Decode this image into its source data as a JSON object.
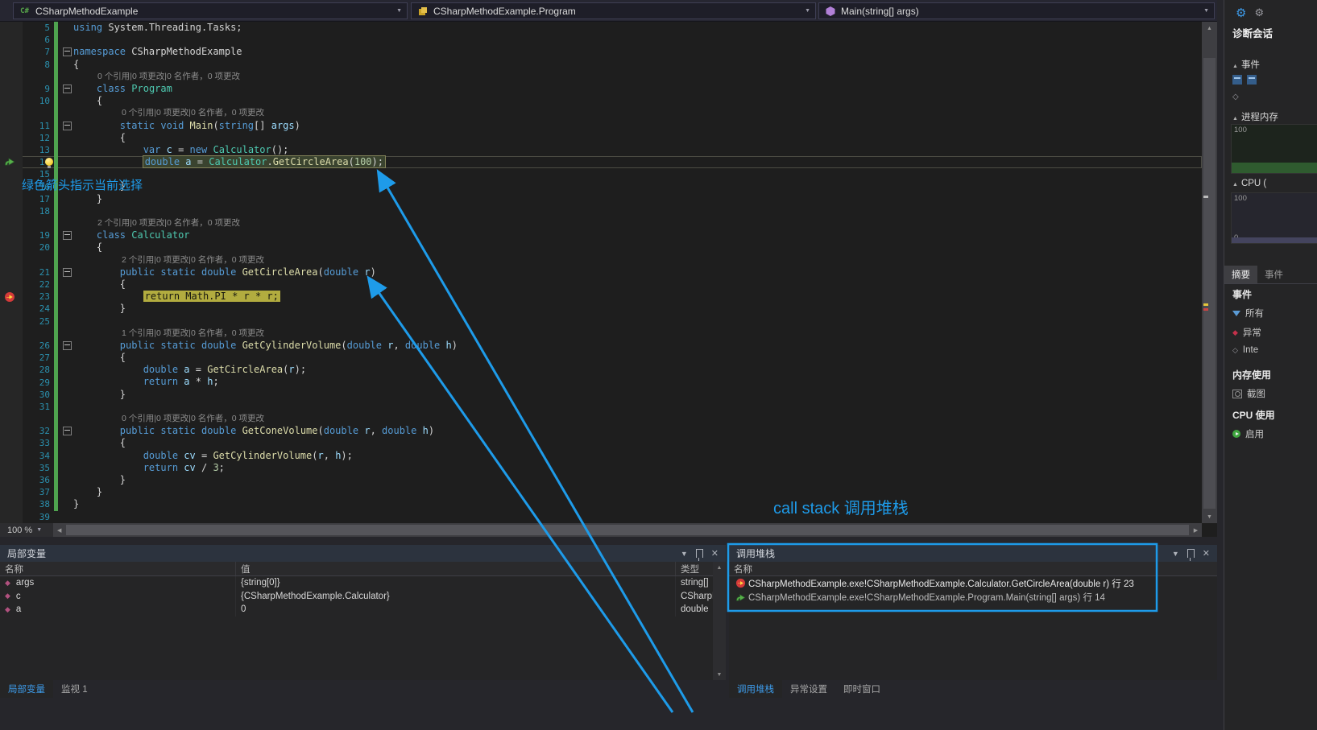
{
  "topbar": {
    "dropdowns": [
      {
        "icon": "csharp-project-icon",
        "label": "CSharpMethodExample"
      },
      {
        "icon": "class-icon",
        "label": "CSharpMethodExample.Program"
      },
      {
        "icon": "method-icon",
        "label": "Main(string[] args)"
      }
    ]
  },
  "editor": {
    "zoom": "100 %",
    "rows": [
      {
        "n": "5",
        "g": 1,
        "t": [
          [
            "kw",
            "using"
          ],
          [
            "pl",
            " System.Threading.Tasks;"
          ]
        ]
      },
      {
        "n": "6",
        "g": 1,
        "t": []
      },
      {
        "n": "7",
        "g": 1,
        "f": 1,
        "t": [
          [
            "kw",
            "namespace"
          ],
          [
            "pl",
            " CSharpMethodExample"
          ]
        ]
      },
      {
        "n": "8",
        "g": 1,
        "t": [
          [
            "pl",
            "{"
          ]
        ]
      },
      {
        "lens": "0 个引用|0 项更改|0 名作者，0 项更改",
        "ind": 30,
        "g": 1
      },
      {
        "n": "9",
        "g": 1,
        "f": 1,
        "t": [
          [
            "pl",
            "    "
          ],
          [
            "kw",
            "class"
          ],
          [
            "pl",
            " "
          ],
          [
            "ty",
            "Program"
          ]
        ]
      },
      {
        "n": "10",
        "g": 1,
        "t": [
          [
            "pl",
            "    {"
          ]
        ]
      },
      {
        "lens": "0 个引用|0 项更改|0 名作者，0 项更改",
        "ind": 60,
        "g": 1
      },
      {
        "n": "11",
        "g": 1,
        "f": 1,
        "t": [
          [
            "pl",
            "        "
          ],
          [
            "kw",
            "static"
          ],
          [
            "pl",
            " "
          ],
          [
            "kw",
            "void"
          ],
          [
            "pl",
            " "
          ],
          [
            "me",
            "Main"
          ],
          [
            "pl",
            "("
          ],
          [
            "kw",
            "string"
          ],
          [
            "pl",
            "[] "
          ],
          [
            "va",
            "args"
          ],
          [
            "pl",
            ")"
          ]
        ]
      },
      {
        "n": "12",
        "g": 1,
        "t": [
          [
            "pl",
            "        {"
          ]
        ]
      },
      {
        "n": "13",
        "g": 1,
        "t": [
          [
            "pl",
            "            "
          ],
          [
            "kw",
            "var"
          ],
          [
            "pl",
            " "
          ],
          [
            "va",
            "c"
          ],
          [
            "pl",
            " = "
          ],
          [
            "kw",
            "new"
          ],
          [
            "pl",
            " "
          ],
          [
            "ty",
            "Calculator"
          ],
          [
            "pl",
            "();"
          ]
        ]
      },
      {
        "n": "14",
        "g": 1,
        "frame": 1,
        "gut": "call",
        "bulb": 1,
        "t": [
          [
            "kw",
            "double"
          ],
          [
            "pl",
            " "
          ],
          [
            "va",
            "a"
          ],
          [
            "pl",
            " = "
          ],
          [
            "ty",
            "Calculator"
          ],
          [
            "pl",
            "."
          ],
          [
            "me",
            "GetCircleArea"
          ],
          [
            "pl",
            "("
          ],
          [
            "nu",
            "100"
          ],
          [
            "pl",
            ");"
          ]
        ]
      },
      {
        "n": "15",
        "g": 1,
        "t": []
      },
      {
        "n": "16",
        "g": 1,
        "t": [
          [
            "pl",
            "        }"
          ]
        ]
      },
      {
        "n": "17",
        "g": 1,
        "t": [
          [
            "pl",
            "    }"
          ]
        ]
      },
      {
        "n": "18",
        "g": 1,
        "t": []
      },
      {
        "lens": "2 个引用|0 项更改|0 名作者，0 项更改",
        "ind": 30,
        "g": 1
      },
      {
        "n": "19",
        "g": 1,
        "f": 1,
        "t": [
          [
            "pl",
            "    "
          ],
          [
            "kw",
            "class"
          ],
          [
            "pl",
            " "
          ],
          [
            "ty",
            "Calculator"
          ]
        ]
      },
      {
        "n": "20",
        "g": 1,
        "t": [
          [
            "pl",
            "    {"
          ]
        ]
      },
      {
        "lens": "2 个引用|0 项更改|0 名作者，0 项更改",
        "ind": 60,
        "g": 1
      },
      {
        "n": "21",
        "g": 1,
        "f": 1,
        "t": [
          [
            "pl",
            "        "
          ],
          [
            "kw",
            "public"
          ],
          [
            "pl",
            " "
          ],
          [
            "kw",
            "static"
          ],
          [
            "pl",
            " "
          ],
          [
            "kw",
            "double"
          ],
          [
            "pl",
            " "
          ],
          [
            "me",
            "GetCircleArea"
          ],
          [
            "pl",
            "("
          ],
          [
            "kw",
            "double"
          ],
          [
            "pl",
            " "
          ],
          [
            "va",
            "r"
          ],
          [
            "pl",
            ")"
          ]
        ]
      },
      {
        "n": "22",
        "g": 1,
        "t": [
          [
            "pl",
            "        {"
          ]
        ]
      },
      {
        "n": "23",
        "g": 1,
        "cur": 1,
        "gut": "bp",
        "t": [
          [
            "pl",
            "return Math.PI * r * r;"
          ]
        ]
      },
      {
        "n": "24",
        "g": 1,
        "t": [
          [
            "pl",
            "        }"
          ]
        ]
      },
      {
        "n": "25",
        "g": 1,
        "t": []
      },
      {
        "lens": "1 个引用|0 项更改|0 名作者，0 项更改",
        "ind": 60,
        "g": 1
      },
      {
        "n": "26",
        "g": 1,
        "f": 1,
        "t": [
          [
            "pl",
            "        "
          ],
          [
            "kw",
            "public"
          ],
          [
            "pl",
            " "
          ],
          [
            "kw",
            "static"
          ],
          [
            "pl",
            " "
          ],
          [
            "kw",
            "double"
          ],
          [
            "pl",
            " "
          ],
          [
            "me",
            "GetCylinderVolume"
          ],
          [
            "pl",
            "("
          ],
          [
            "kw",
            "double"
          ],
          [
            "pl",
            " "
          ],
          [
            "va",
            "r"
          ],
          [
            "pl",
            ", "
          ],
          [
            "kw",
            "double"
          ],
          [
            "pl",
            " "
          ],
          [
            "va",
            "h"
          ],
          [
            "pl",
            ")"
          ]
        ]
      },
      {
        "n": "27",
        "g": 1,
        "t": [
          [
            "pl",
            "        {"
          ]
        ]
      },
      {
        "n": "28",
        "g": 1,
        "t": [
          [
            "pl",
            "            "
          ],
          [
            "kw",
            "double"
          ],
          [
            "pl",
            " "
          ],
          [
            "va",
            "a"
          ],
          [
            "pl",
            " = "
          ],
          [
            "me",
            "GetCircleArea"
          ],
          [
            "pl",
            "("
          ],
          [
            "va",
            "r"
          ],
          [
            "pl",
            ");"
          ]
        ]
      },
      {
        "n": "29",
        "g": 1,
        "t": [
          [
            "pl",
            "            "
          ],
          [
            "kw",
            "return"
          ],
          [
            "pl",
            " "
          ],
          [
            "va",
            "a"
          ],
          [
            "pl",
            " * "
          ],
          [
            "va",
            "h"
          ],
          [
            "pl",
            ";"
          ]
        ]
      },
      {
        "n": "30",
        "g": 1,
        "t": [
          [
            "pl",
            "        }"
          ]
        ]
      },
      {
        "n": "31",
        "g": 1,
        "t": []
      },
      {
        "lens": "0 个引用|0 项更改|0 名作者，0 项更改",
        "ind": 60,
        "g": 1
      },
      {
        "n": "32",
        "g": 1,
        "f": 1,
        "t": [
          [
            "pl",
            "        "
          ],
          [
            "kw",
            "public"
          ],
          [
            "pl",
            " "
          ],
          [
            "kw",
            "static"
          ],
          [
            "pl",
            " "
          ],
          [
            "kw",
            "double"
          ],
          [
            "pl",
            " "
          ],
          [
            "me",
            "GetConeVolume"
          ],
          [
            "pl",
            "("
          ],
          [
            "kw",
            "double"
          ],
          [
            "pl",
            " "
          ],
          [
            "va",
            "r"
          ],
          [
            "pl",
            ", "
          ],
          [
            "kw",
            "double"
          ],
          [
            "pl",
            " "
          ],
          [
            "va",
            "h"
          ],
          [
            "pl",
            ")"
          ]
        ]
      },
      {
        "n": "33",
        "g": 1,
        "t": [
          [
            "pl",
            "        {"
          ]
        ]
      },
      {
        "n": "34",
        "g": 1,
        "t": [
          [
            "pl",
            "            "
          ],
          [
            "kw",
            "double"
          ],
          [
            "pl",
            " "
          ],
          [
            "va",
            "cv"
          ],
          [
            "pl",
            " = "
          ],
          [
            "me",
            "GetCylinderVolume"
          ],
          [
            "pl",
            "("
          ],
          [
            "va",
            "r"
          ],
          [
            "pl",
            ", "
          ],
          [
            "va",
            "h"
          ],
          [
            "pl",
            ");"
          ]
        ]
      },
      {
        "n": "35",
        "g": 1,
        "t": [
          [
            "pl",
            "            "
          ],
          [
            "kw",
            "return"
          ],
          [
            "pl",
            " "
          ],
          [
            "va",
            "cv"
          ],
          [
            "pl",
            " / "
          ],
          [
            "nu",
            "3"
          ],
          [
            "pl",
            ";"
          ]
        ]
      },
      {
        "n": "36",
        "g": 1,
        "t": [
          [
            "pl",
            "        }"
          ]
        ]
      },
      {
        "n": "37",
        "g": 1,
        "t": [
          [
            "pl",
            "    }"
          ]
        ]
      },
      {
        "n": "38",
        "g": 1,
        "t": [
          [
            "pl",
            "}"
          ]
        ]
      },
      {
        "n": "39",
        "t": []
      }
    ]
  },
  "annotations": {
    "selection_note": "绿色箭头指示当前选择",
    "callstack_note": "call stack 调用堆栈"
  },
  "locals": {
    "title": "局部变量",
    "columns": [
      "名称",
      "值",
      "类型"
    ],
    "rows": [
      {
        "icon": "variable-diamond",
        "name": "args",
        "value": "{string[0]}",
        "type": "string[]"
      },
      {
        "icon": "variable-diamond",
        "name": "c",
        "value": "{CSharpMethodExample.Calculator}",
        "type": "CSharpM"
      },
      {
        "icon": "variable-diamond",
        "name": "a",
        "value": "0",
        "type": "double"
      }
    ],
    "tabs": [
      {
        "label": "局部变量",
        "active": true
      },
      {
        "label": "监视 1",
        "active": false
      }
    ]
  },
  "callstack": {
    "title": "调用堆栈",
    "columns": [
      "名称"
    ],
    "rows": [
      {
        "icon": "current-frame",
        "text": "CSharpMethodExample.exe!CSharpMethodExample.Calculator.GetCircleArea(double r) 行 23"
      },
      {
        "icon": "calling-frame",
        "text": "CSharpMethodExample.exe!CSharpMethodExample.Program.Main(string[] args) 行 14"
      }
    ],
    "tabs": [
      {
        "label": "调用堆栈",
        "active": true
      },
      {
        "label": "异常设置",
        "active": false
      },
      {
        "label": "即时窗口",
        "active": false
      }
    ]
  },
  "diagnostics": {
    "title": "诊断会话",
    "sections": {
      "events": "事件",
      "process_memory": "进程内存",
      "cpu": "CPU ("
    },
    "charts": {
      "memory_max": "100",
      "memory_min": "0",
      "cpu_max": "100",
      "cpu_min": "0"
    },
    "tabs": [
      {
        "label": "摘要",
        "active": true
      },
      {
        "label": "事件",
        "active": false
      }
    ],
    "summary": {
      "events_title": "事件",
      "all_events": "所有",
      "exceptions": "异常",
      "intellitrace": "Inte",
      "memory_title": "内存使用",
      "snapshot": "截图",
      "cpu_title": "CPU 使用",
      "enable": "启用"
    }
  }
}
